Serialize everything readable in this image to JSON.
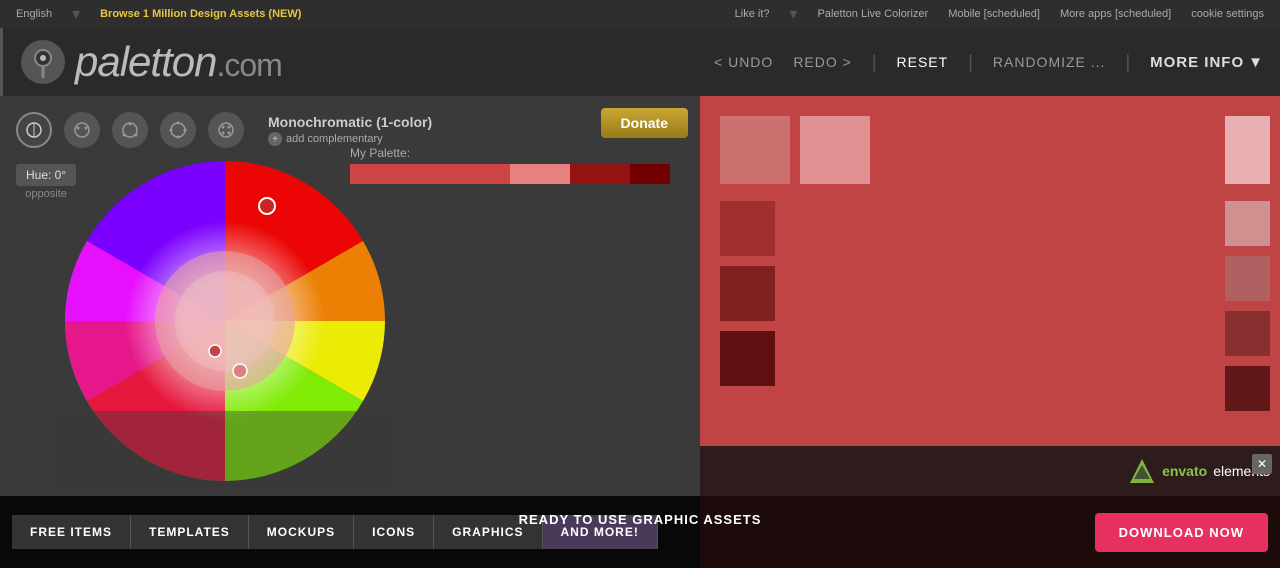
{
  "topnav": {
    "language": "English",
    "browse": "Browse 1 Million Design Assets (NEW)",
    "likeit": "Like it?",
    "colorizer": "Paletton Live Colorizer",
    "mobile": "Mobile [scheduled]",
    "moreapps": "More apps [scheduled]",
    "cookie": "cookie settings"
  },
  "header": {
    "logo_text": "paletton",
    "logo_domain": ".com",
    "undo": "< UNDO",
    "redo": "REDO >",
    "reset": "RESET",
    "randomize": "RANDOMIZE ...",
    "more_info": "MORE INFO",
    "more_info_arrow": "▼"
  },
  "toolbar": {
    "donate_label": "Donate"
  },
  "color_wheel": {
    "mode_name": "Monochromatic (1-color)",
    "add_complementary": "add complementary",
    "hue_label": "Hue: 0°",
    "opposite_label": "opposite"
  },
  "palette": {
    "my_palette": "My Palette:",
    "colors": [
      "#c44",
      "#e88",
      "#944",
      "#722"
    ]
  },
  "swatches": {
    "main_bg": "#c04444",
    "light1": "#e08080",
    "light2": "#eeaaaa",
    "dark1": "#802020",
    "dark2": "#600000",
    "right_light1": "#e88",
    "right_dark1": "#944",
    "right_dark2": "#722"
  },
  "envato": {
    "logo_text": "envato elements",
    "close_label": "✕"
  },
  "banner": {
    "ready_text": "READY TO USE GRAPHIC ASSETS",
    "items": [
      {
        "label": "FREE ITEMS"
      },
      {
        "label": "TEMPLATES"
      },
      {
        "label": "MOCKUPS"
      },
      {
        "label": "ICONS"
      },
      {
        "label": "GRAPHICS"
      },
      {
        "label": "AND MORE!"
      }
    ],
    "download_label": "DOWNLOAD NOW"
  }
}
